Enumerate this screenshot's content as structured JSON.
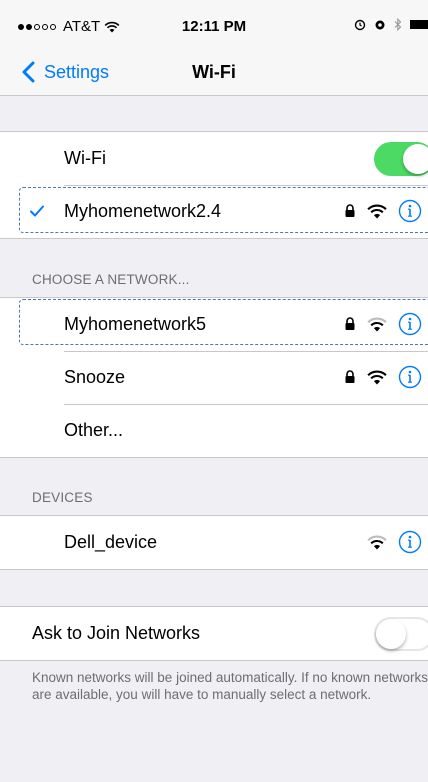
{
  "status_bar": {
    "carrier": "AT&T",
    "time": "12:11 PM",
    "signal_bars_filled": 2,
    "signal_bars_total": 5,
    "icons": [
      "wifi-icon",
      "alarm-icon",
      "location-icon",
      "bluetooth-icon",
      "battery-icon"
    ]
  },
  "nav": {
    "back_label": "Settings",
    "title": "Wi-Fi"
  },
  "wifi_toggle": {
    "label": "Wi-Fi",
    "on": true
  },
  "connected_network": {
    "name": "Myhomenetwork2.4",
    "checked": true,
    "secured": true,
    "icons": [
      "lock-icon",
      "wifi-icon",
      "info-icon"
    ]
  },
  "choose_section": {
    "header": "CHOOSE A NETWORK...",
    "networks": [
      {
        "name": "Myhomenetwork5",
        "secured": true,
        "icons": [
          "lock-icon",
          "wifi-icon",
          "info-icon"
        ]
      },
      {
        "name": "Snooze",
        "secured": true,
        "icons": [
          "lock-icon",
          "wifi-icon",
          "info-icon"
        ]
      },
      {
        "name": "Other...",
        "secured": false,
        "icons": []
      }
    ]
  },
  "devices_section": {
    "header": "DEVICES",
    "devices": [
      {
        "name": "Dell_device",
        "icons": [
          "wifi-icon",
          "info-icon"
        ]
      }
    ]
  },
  "ask_to_join": {
    "label": "Ask to Join Networks",
    "on": false,
    "note": "Known networks will be joined automatically. If no known networks are available, you will have to manually select a network."
  },
  "colors": {
    "accent": "#007aff",
    "toggle_on": "#4cd964",
    "background": "#efeff4",
    "section_text": "#6d6d72",
    "highlight_border": "#4a78b4"
  }
}
